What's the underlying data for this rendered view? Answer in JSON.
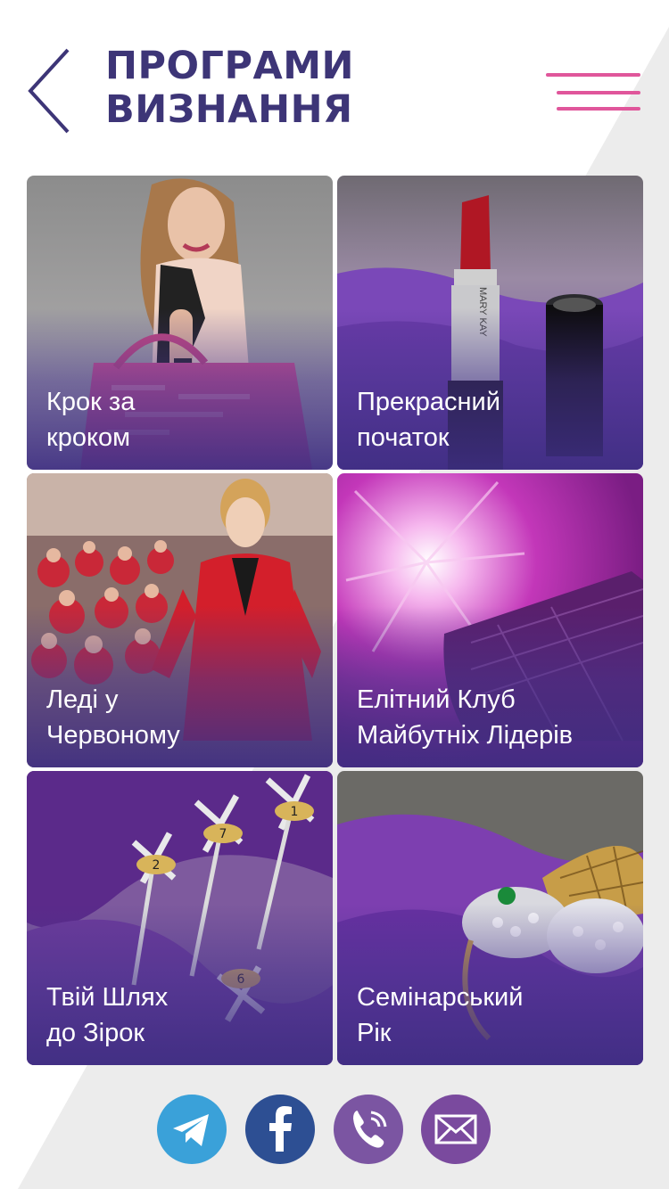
{
  "header": {
    "title_line1": "ПРОГРАМИ",
    "title_line2": "ВИЗНАННЯ",
    "back_icon": "chevron-left-icon",
    "menu_icon": "hamburger-menu-icon"
  },
  "tiles": [
    {
      "line1": "Крок за",
      "line2": "кроком",
      "image": "woman-with-pink-bag"
    },
    {
      "line1": "Прекрасний",
      "line2": "початок",
      "image": "mary-kay-lipstick"
    },
    {
      "line1": "Леді у",
      "line2": "Червоному",
      "image": "women-in-red"
    },
    {
      "line1": "Елітний Клуб",
      "line2": "Майбутніх Лідерів",
      "image": "purple-clutch"
    },
    {
      "line1": "Твій Шлях",
      "line2": "до Зірок",
      "image": "star-pins"
    },
    {
      "line1": "Семінарський",
      "line2": "Рік",
      "image": "jeweled-bee-brooch"
    }
  ],
  "lipstick_brand": "MARY KAY",
  "pin_numbers": [
    "2",
    "7",
    "1",
    "6"
  ],
  "social": [
    {
      "name": "telegram",
      "icon": "telegram-icon",
      "color": "#3aa1d9"
    },
    {
      "name": "facebook",
      "icon": "facebook-icon",
      "color": "#2d4f93"
    },
    {
      "name": "viber",
      "icon": "viber-icon",
      "color": "#7b55a2"
    },
    {
      "name": "email",
      "icon": "envelope-icon",
      "color": "#7a4a9e"
    }
  ],
  "colors": {
    "title": "#3d3577",
    "menu": "#e0569b",
    "tile_overlay": "#3e2e82"
  }
}
